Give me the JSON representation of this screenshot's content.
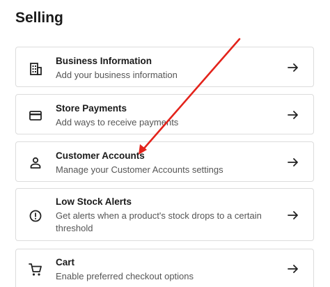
{
  "page": {
    "title": "Selling"
  },
  "cards": [
    {
      "label": "Business Information",
      "description": "Add your business information",
      "icon": "building-icon"
    },
    {
      "label": "Store Payments",
      "description": "Add ways to receive payments",
      "icon": "credit-card-icon"
    },
    {
      "label": "Customer Accounts",
      "description": "Manage your Customer Accounts settings",
      "icon": "person-icon"
    },
    {
      "label": "Low Stock Alerts",
      "description": "Get alerts when a product's stock drops to a certain threshold",
      "icon": "alert-circle-icon"
    },
    {
      "label": "Cart",
      "description": "Enable preferred checkout options",
      "icon": "cart-icon"
    }
  ],
  "colors": {
    "annotation_arrow": "#e3231b",
    "border": "#dcdcdc"
  }
}
